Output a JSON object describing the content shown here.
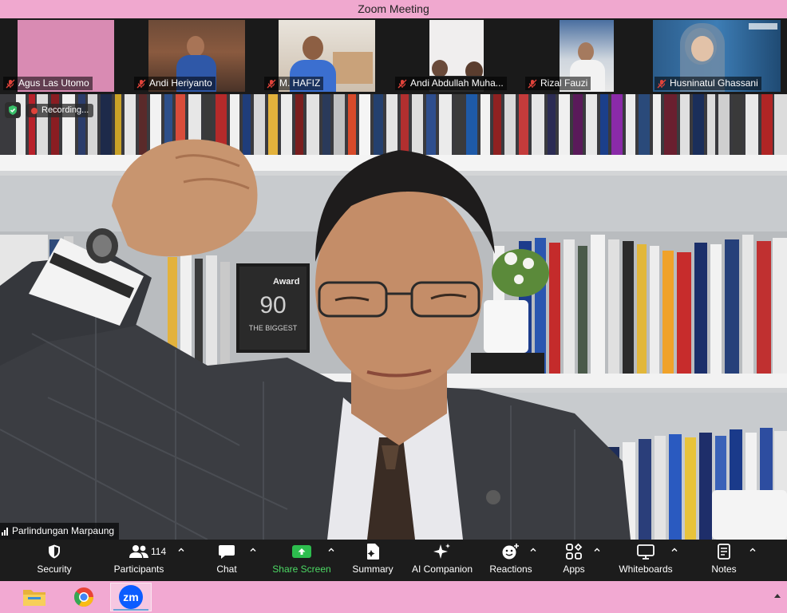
{
  "window": {
    "title": "Zoom Meeting"
  },
  "participants_strip": [
    {
      "name": "Agus Las Utomo",
      "muted": true
    },
    {
      "name": "Andi Heriyanto",
      "muted": true
    },
    {
      "name": "M. HAFIZ",
      "muted": true
    },
    {
      "name": "Andi Abdullah Muha...",
      "muted": true
    },
    {
      "name": "Rizal Fauzi",
      "muted": true
    },
    {
      "name": "Husninatul Ghassani",
      "muted": true
    }
  ],
  "main_video": {
    "speaker_name": "Parlindungan Marpaung",
    "recording_label": "Recording...",
    "book_cover_text": [
      "Award",
      "90",
      "THE BIGGEST"
    ]
  },
  "toolbar": {
    "security": "Security",
    "participants": "Participants",
    "participants_count": "114",
    "chat": "Chat",
    "share_screen": "Share Screen",
    "summary": "Summary",
    "ai_companion": "AI Companion",
    "reactions": "Reactions",
    "apps": "Apps",
    "whiteboards": "Whiteboards",
    "notes": "Notes"
  },
  "taskbar": {
    "items": [
      "file-explorer-icon",
      "chrome-icon",
      "zoom-icon"
    ],
    "zoom_label": "zm"
  },
  "colors": {
    "titlebar": "#f0a8cf",
    "taskbar": "#f2a9d2",
    "toolbar": "#1c1c1c",
    "share_green": "#4cd964",
    "mute_red": "#e0433a"
  }
}
